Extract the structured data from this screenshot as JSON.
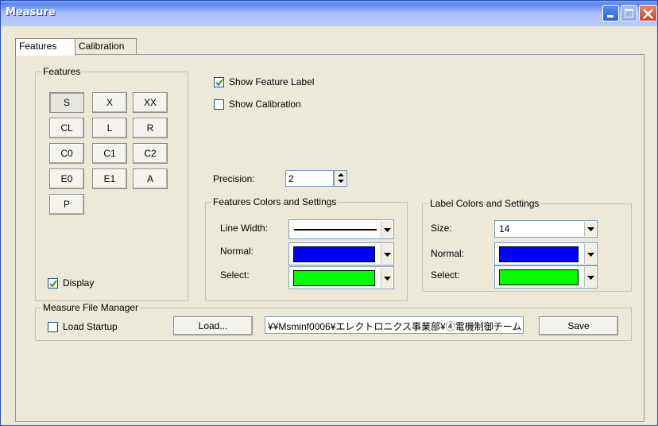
{
  "window": {
    "title": "Measure"
  },
  "tabs": [
    {
      "label": "Features",
      "active": true
    },
    {
      "label": "Calibration",
      "active": false
    }
  ],
  "features_group": {
    "label": "Features",
    "buttons": [
      "S",
      "X",
      "XX",
      "CL",
      "L",
      "R",
      "C0",
      "C1",
      "C2",
      "E0",
      "E1",
      "A",
      "P"
    ],
    "pressed": "S",
    "display": {
      "label": "Display",
      "checked": true
    }
  },
  "options": {
    "show_feature_label": {
      "label": "Show Feature Label",
      "checked": true
    },
    "show_calibration": {
      "label": "Show Calibration",
      "checked": false
    },
    "precision": {
      "label": "Precision:",
      "value": "2"
    }
  },
  "features_colors": {
    "label": "Features Colors and Settings",
    "line_width_label": "Line Width:",
    "normal_label": "Normal:",
    "normal_color": "#0000ff",
    "select_label": "Select:",
    "select_color": "#00ff00"
  },
  "label_colors": {
    "label": "Label Colors and Settings",
    "size_label": "Size:",
    "size_value": "14",
    "normal_label": "Normal:",
    "normal_color": "#0000ff",
    "select_label": "Select:",
    "select_color": "#00ff00"
  },
  "file_manager": {
    "label": "Measure File Manager",
    "load_startup": {
      "label": "Load Startup",
      "checked": false
    },
    "load_button": "Load...",
    "path": "¥¥Msminf0006¥エレクトロニクス事業部¥④電機制御チーム",
    "save_button": "Save"
  },
  "colors": {
    "title_bar": "#5a85ee",
    "face": "#ece9d8"
  }
}
